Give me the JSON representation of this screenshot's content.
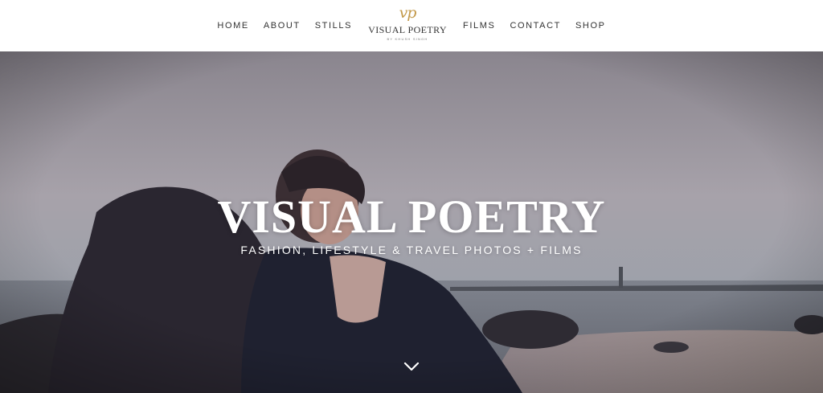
{
  "nav": {
    "left": [
      {
        "label": "HOME"
      },
      {
        "label": "ABOUT"
      },
      {
        "label": "STILLS"
      }
    ],
    "right": [
      {
        "label": "FILMS"
      },
      {
        "label": "CONTACT"
      },
      {
        "label": "SHOP"
      }
    ]
  },
  "logo": {
    "monogram": "vp",
    "title": "VISUAL POETRY",
    "byline": "BY KHUSH SINGH"
  },
  "hero": {
    "title": "VISUAL POETRY",
    "subtitle": "FASHION, LIFESTYLE & TRAVEL PHOTOS + FILMS",
    "scroll_icon": "chevron-down-icon"
  },
  "colors": {
    "accent_gold": "#c39a4b",
    "nav_text": "#333333",
    "hero_text": "#ffffff"
  }
}
